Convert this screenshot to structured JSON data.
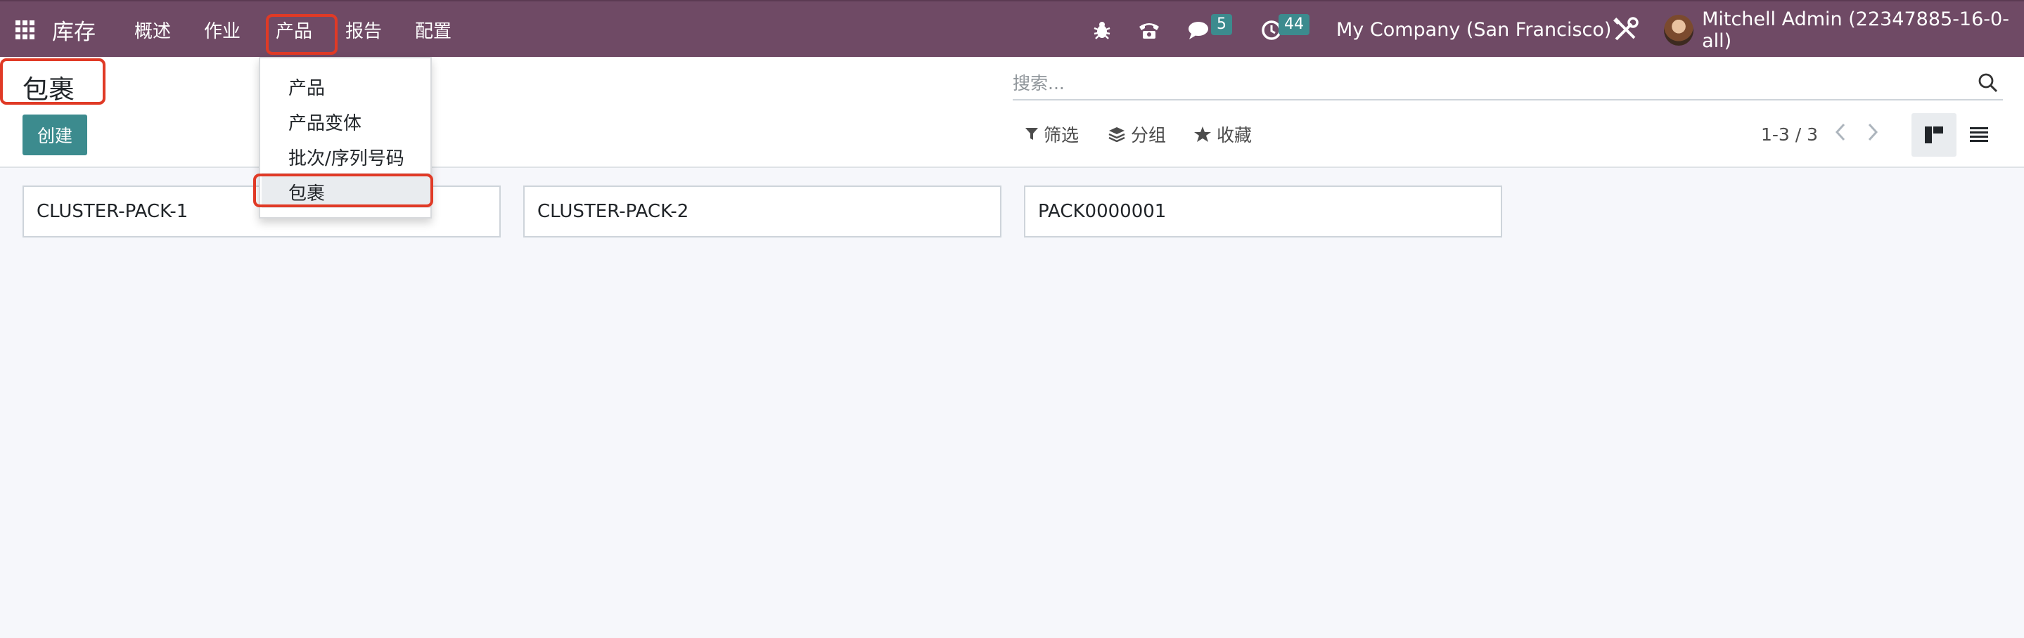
{
  "navbar": {
    "app_name": "库存",
    "menus": [
      "概述",
      "作业",
      "产品",
      "报告",
      "配置"
    ],
    "messages_count": "5",
    "activities_count": "44",
    "company": "My Company (San Francisco)",
    "user": "Mitchell Admin (22347885-16-0-all)",
    "colors": {
      "background": "#6f4a65",
      "badge": "#3c8b8e",
      "highlight": "#e03a26"
    }
  },
  "products_dropdown": {
    "items": [
      "产品",
      "产品变体",
      "批次/序列号码",
      "包裹"
    ],
    "active_item": "包裹"
  },
  "control_panel": {
    "title": "包裹",
    "create_label": "创建",
    "search_placeholder": "搜索...",
    "filter_label": "筛选",
    "group_label": "分组",
    "favorites_label": "收藏",
    "pager": "1-3 / 3"
  },
  "kanban": {
    "cards": [
      "CLUSTER-PACK-1",
      "CLUSTER-PACK-2",
      "PACK0000001"
    ]
  },
  "icons": [
    "apps-grid-icon",
    "bug-icon",
    "phone-icon",
    "chat-icon",
    "clock-icon",
    "tools-icon",
    "search-icon",
    "filter-icon",
    "layers-icon",
    "star-icon",
    "chevron-left-icon",
    "chevron-right-icon",
    "kanban-view-icon",
    "list-view-icon"
  ]
}
